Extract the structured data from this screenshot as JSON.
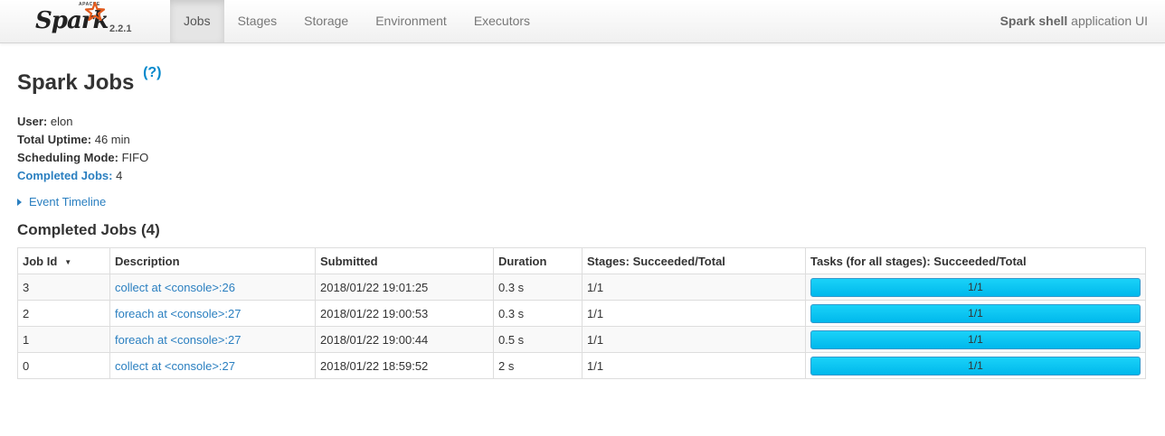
{
  "navbar": {
    "logo_apache": "APACHE",
    "logo_text": "Spark",
    "version": "2.2.1",
    "tabs": [
      {
        "label": "Jobs",
        "active": true
      },
      {
        "label": "Stages",
        "active": false
      },
      {
        "label": "Storage",
        "active": false
      },
      {
        "label": "Environment",
        "active": false
      },
      {
        "label": "Executors",
        "active": false
      }
    ],
    "app_name_bold": "Spark shell",
    "app_name_rest": "application UI"
  },
  "page": {
    "title": "Spark Jobs",
    "help": "(?)",
    "summary": {
      "user_label": "User:",
      "user_value": "elon",
      "uptime_label": "Total Uptime:",
      "uptime_value": "46 min",
      "mode_label": "Scheduling Mode:",
      "mode_value": "FIFO",
      "completed_label": "Completed Jobs:",
      "completed_value": "4"
    },
    "event_timeline": "Event Timeline",
    "section_title": "Completed Jobs (4)"
  },
  "table": {
    "headers": [
      "Job Id",
      "Description",
      "Submitted",
      "Duration",
      "Stages: Succeeded/Total",
      "Tasks (for all stages): Succeeded/Total"
    ],
    "sort_indicator": "▼",
    "rows": [
      {
        "id": "3",
        "description": "collect at <console>:26",
        "submitted": "2018/01/22 19:01:25",
        "duration": "0.3 s",
        "stages": "1/1",
        "tasks": "1/1",
        "tasks_fraction": 1.0
      },
      {
        "id": "2",
        "description": "foreach at <console>:27",
        "submitted": "2018/01/22 19:00:53",
        "duration": "0.3 s",
        "stages": "1/1",
        "tasks": "1/1",
        "tasks_fraction": 1.0
      },
      {
        "id": "1",
        "description": "foreach at <console>:27",
        "submitted": "2018/01/22 19:00:44",
        "duration": "0.5 s",
        "stages": "1/1",
        "tasks": "1/1",
        "tasks_fraction": 1.0
      },
      {
        "id": "0",
        "description": "collect at <console>:27",
        "submitted": "2018/01/22 18:59:52",
        "duration": "2 s",
        "stages": "1/1",
        "tasks": "1/1",
        "tasks_fraction": 1.0
      }
    ]
  },
  "colors": {
    "link": "#2a7fc0",
    "progress_fill": "#0bc6f0",
    "logo_orange": "#e25a1c"
  }
}
